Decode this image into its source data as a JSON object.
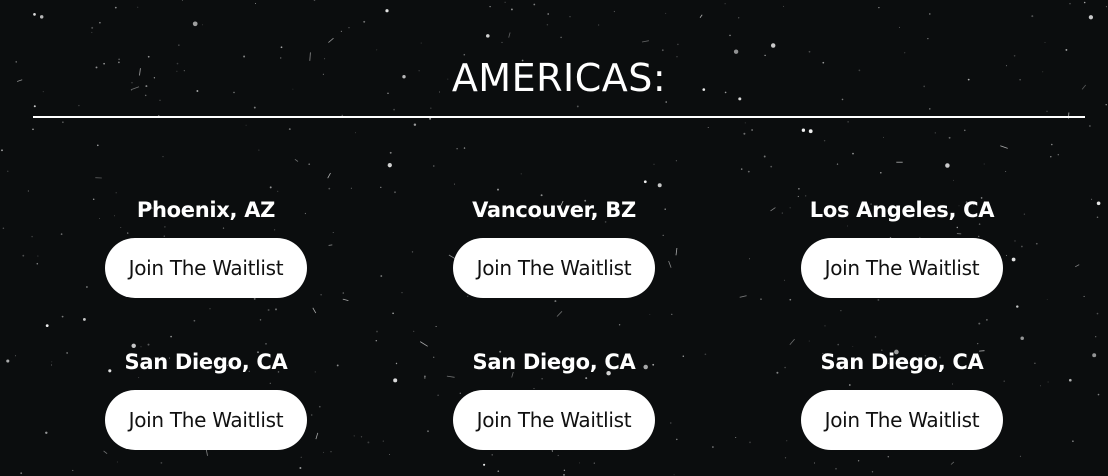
{
  "region": {
    "heading": "AMERICAS:"
  },
  "locations": [
    {
      "city": "Phoenix, AZ",
      "button_label": "Join The Waitlist"
    },
    {
      "city": "Vancouver, BZ",
      "button_label": "Join The Waitlist"
    },
    {
      "city": "Los Angeles, CA",
      "button_label": "Join The Waitlist"
    },
    {
      "city": "San Diego, CA",
      "button_label": "Join The Waitlist"
    },
    {
      "city": "San Diego, CA",
      "button_label": "Join The Waitlist"
    },
    {
      "city": "San Diego, CA",
      "button_label": "Join The Waitlist"
    }
  ],
  "colors": {
    "background": "#0b0d0e",
    "text": "#ffffff",
    "button_background": "#ffffff",
    "button_text": "#111111"
  }
}
